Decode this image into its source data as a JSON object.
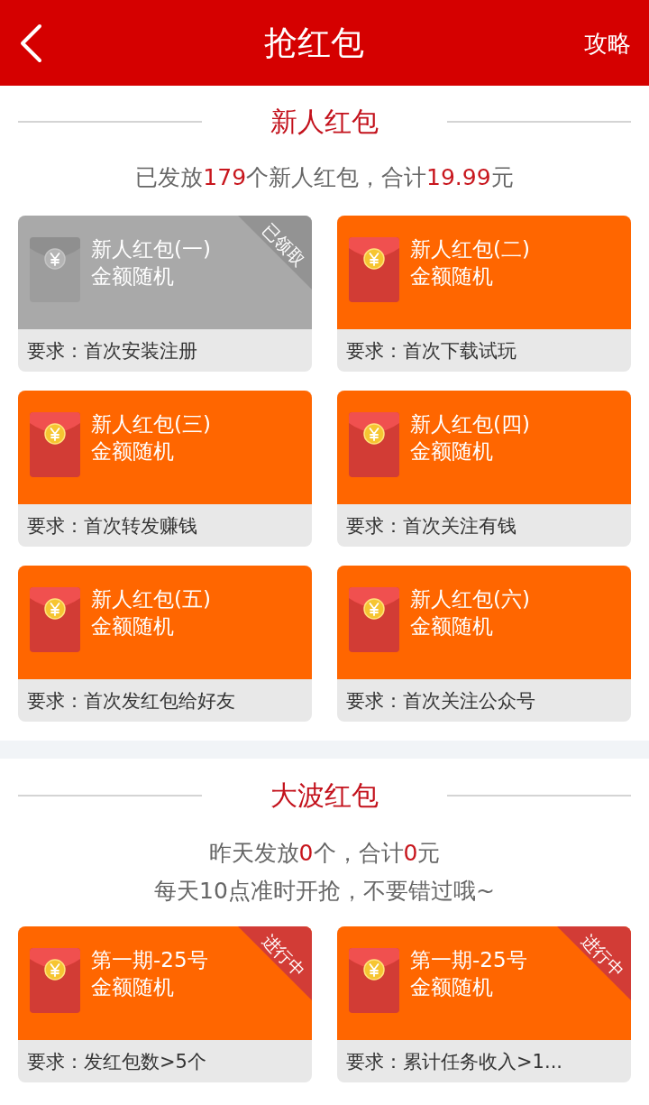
{
  "header": {
    "title": "抢红包",
    "action": "攻略"
  },
  "sections": [
    {
      "title": "新人红包",
      "summary": [
        [
          {
            "text": "已发放",
            "highlight": false
          },
          {
            "text": "179",
            "highlight": true
          },
          {
            "text": "个新人红包，合计",
            "highlight": false
          },
          {
            "text": "19.99",
            "highlight": true
          },
          {
            "text": "元",
            "highlight": false
          }
        ]
      ],
      "cards": [
        {
          "title": "新人红包(一)",
          "subtitle": "金额随机",
          "requirement": "要求：首次安装注册",
          "claimed": true,
          "badge": {
            "kind": "claimed",
            "text": "已领取"
          }
        },
        {
          "title": "新人红包(二)",
          "subtitle": "金额随机",
          "requirement": "要求：首次下载试玩",
          "claimed": false
        },
        {
          "title": "新人红包(三)",
          "subtitle": "金额随机",
          "requirement": "要求：首次转发赚钱",
          "claimed": false
        },
        {
          "title": "新人红包(四)",
          "subtitle": "金额随机",
          "requirement": "要求：首次关注有钱",
          "claimed": false
        },
        {
          "title": "新人红包(五)",
          "subtitle": "金额随机",
          "requirement": "要求：首次发红包给好友",
          "claimed": false
        },
        {
          "title": "新人红包(六)",
          "subtitle": "金额随机",
          "requirement": "要求：首次关注公众号",
          "claimed": false
        }
      ]
    },
    {
      "title": "大波红包",
      "summary": [
        [
          {
            "text": "昨天发放",
            "highlight": false
          },
          {
            "text": "0",
            "highlight": true
          },
          {
            "text": "个，合计",
            "highlight": false
          },
          {
            "text": "0",
            "highlight": true
          },
          {
            "text": "元",
            "highlight": false
          }
        ],
        [
          {
            "text": "每天10点准时开抢，不要错过哦~",
            "highlight": false
          }
        ]
      ],
      "cards": [
        {
          "title": "第一期-25号",
          "subtitle": "金额随机",
          "requirement": "要求：发红包数>5个",
          "claimed": false,
          "badge": {
            "kind": "ongoing",
            "text": "进行中"
          }
        },
        {
          "title": "第一期-25号",
          "subtitle": "金额随机",
          "requirement": "要求：累计任务收入>1...",
          "claimed": false,
          "badge": {
            "kind": "ongoing",
            "text": "进行中"
          }
        }
      ]
    }
  ]
}
